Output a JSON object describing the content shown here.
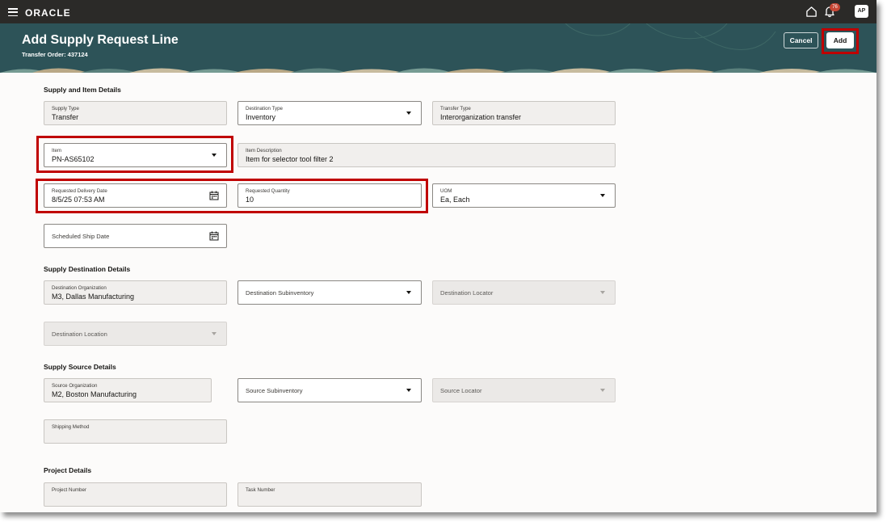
{
  "topbar": {
    "brand": "ORACLE",
    "icons": [
      "menu-icon",
      "home-icon",
      "bell-icon"
    ],
    "notification_count": "76",
    "user_initials": "AP"
  },
  "header": {
    "title": "Add Supply Request Line",
    "subtitle": "Transfer Order: 437124",
    "cancel_label": "Cancel",
    "add_label": "Add"
  },
  "sections": {
    "supply_item": "Supply and Item Details",
    "destination": "Supply Destination Details",
    "source": "Supply Source Details",
    "project": "Project Details"
  },
  "fields": {
    "supply_type": {
      "label": "Supply Type",
      "value": "Transfer"
    },
    "destination_type": {
      "label": "Destination Type",
      "value": "Inventory"
    },
    "transfer_type": {
      "label": "Transfer Type",
      "value": "Interorganization transfer"
    },
    "item": {
      "label": "Item",
      "value": "PN-AS65102"
    },
    "item_description": {
      "label": "Item Description",
      "value": "Item for selector tool filter 2"
    },
    "requested_delivery_date": {
      "label": "Requested Delivery Date",
      "value": "8/5/25 07:53 AM"
    },
    "requested_quantity": {
      "label": "Requested Quantity",
      "value": "10"
    },
    "uom": {
      "label": "UOM",
      "value": "Ea, Each"
    },
    "scheduled_ship_date": {
      "label": "Scheduled Ship Date"
    },
    "destination_organization": {
      "label": "Destination Organization",
      "value": "M3, Dallas Manufacturing"
    },
    "destination_subinventory": {
      "label": "Destination Subinventory"
    },
    "destination_locator": {
      "label": "Destination Locator"
    },
    "destination_location": {
      "label": "Destination Location"
    },
    "source_organization": {
      "label": "Source Organization",
      "value": "M2, Boston Manufacturing"
    },
    "source_subinventory": {
      "label": "Source Subinventory"
    },
    "source_locator": {
      "label": "Source Locator"
    },
    "shipping_method": {
      "label": "Shipping Method"
    },
    "project_number": {
      "label": "Project Number"
    },
    "task_number": {
      "label": "Task Number"
    }
  },
  "colors": {
    "topbar": "#2b2a28",
    "header": "#2d5358",
    "highlight": "#c00000",
    "badge": "#c74634"
  }
}
